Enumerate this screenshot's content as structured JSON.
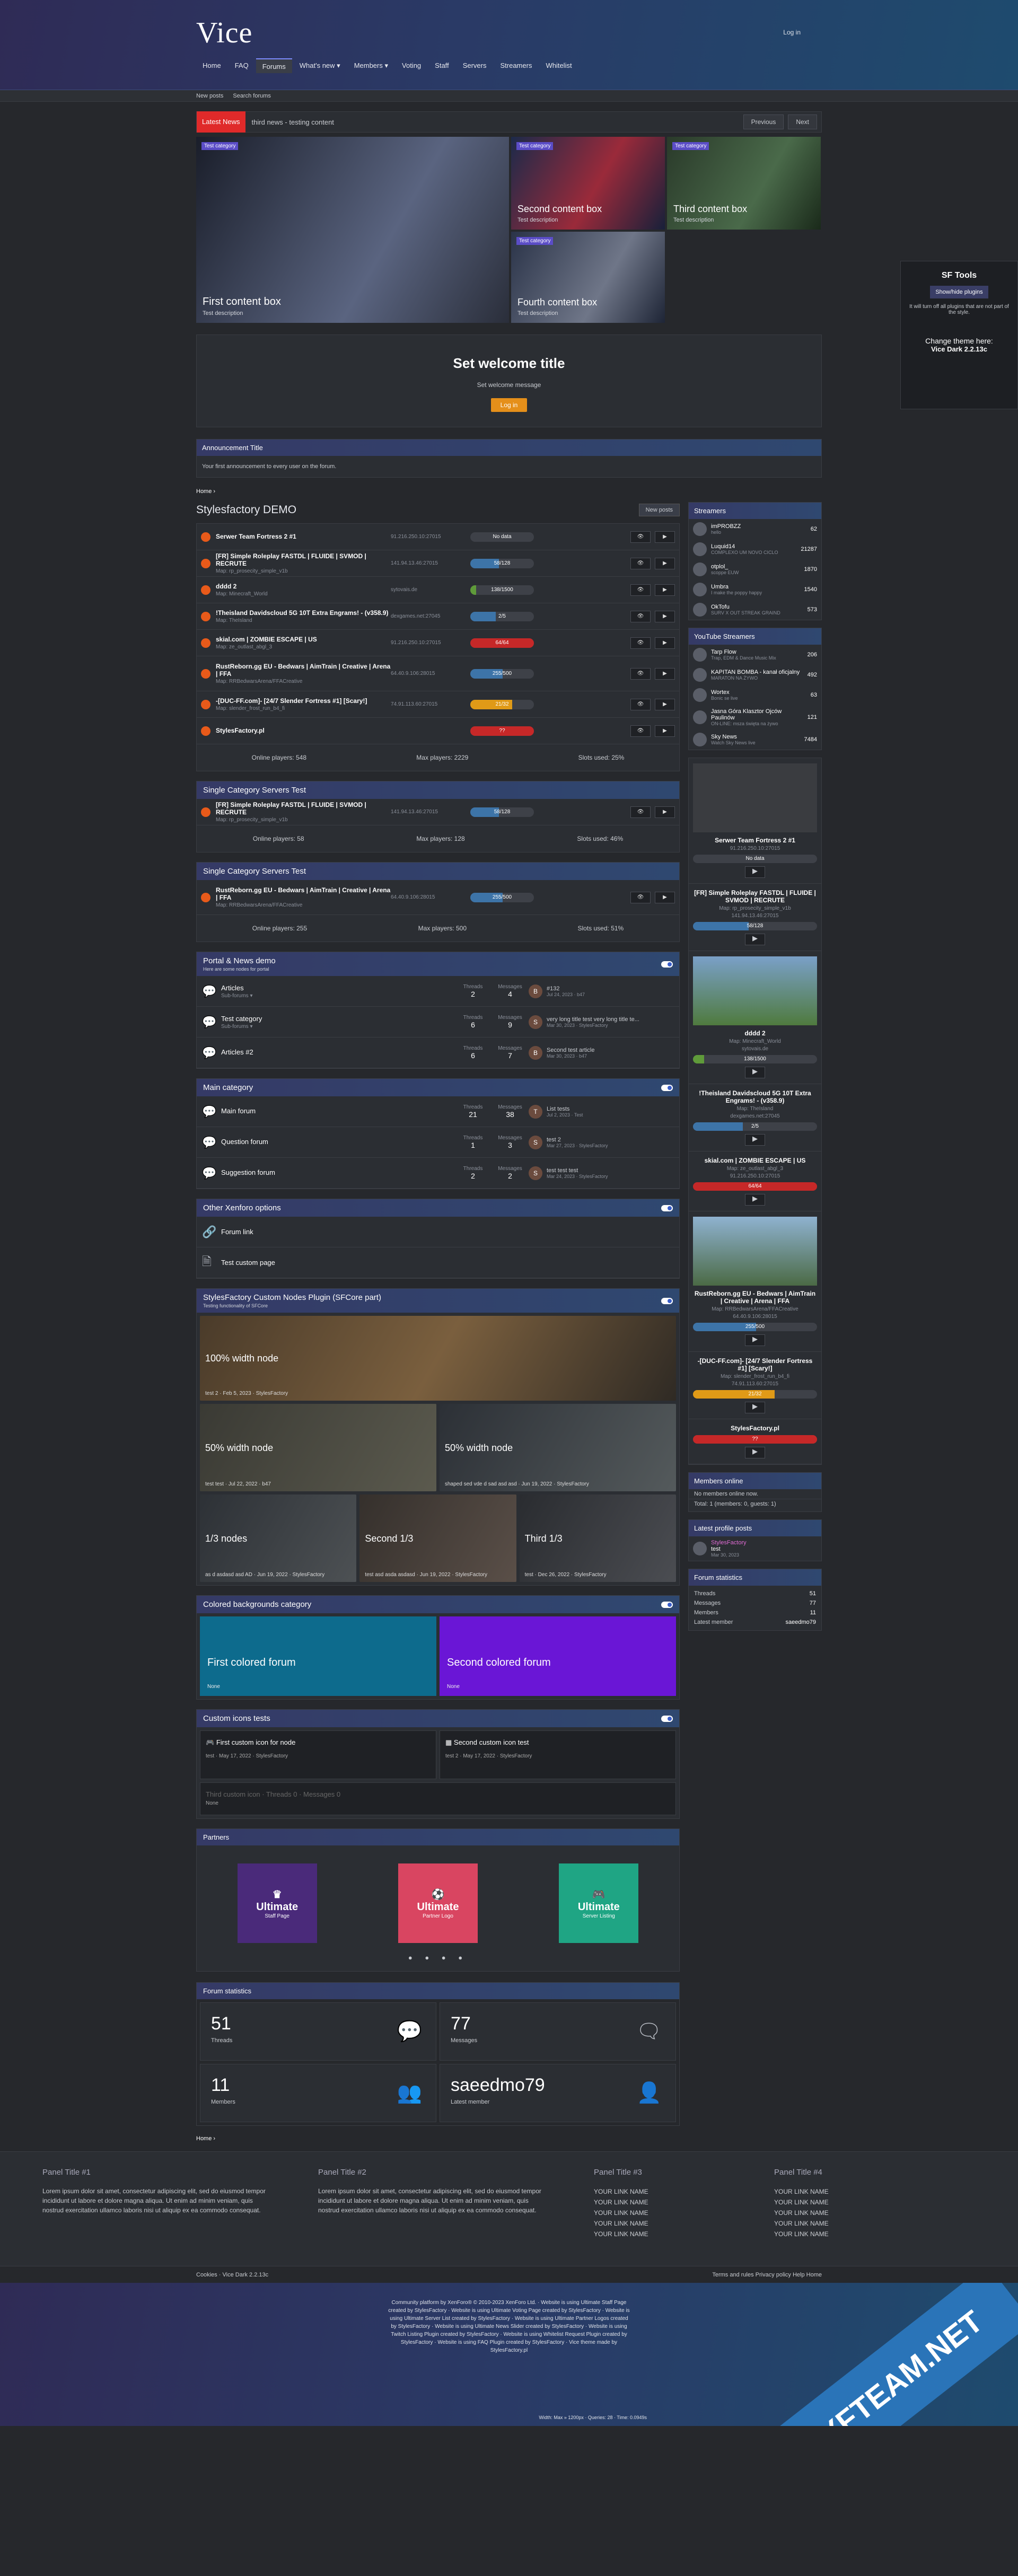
{
  "header": {
    "logo": "Vice",
    "login": "Log in",
    "nav": [
      "Home",
      "FAQ",
      "Forums",
      "What's new ▾",
      "Members ▾",
      "Voting",
      "Staff",
      "Servers",
      "Streamers",
      "Whitelist"
    ],
    "subnav": [
      "New posts",
      "Search forums"
    ]
  },
  "ticker": {
    "label": "Latest News",
    "text": "third news - testing content",
    "prev": "Previous",
    "next": "Next"
  },
  "slides": [
    {
      "tag": "Test category",
      "title": "First content box",
      "desc": "Test description"
    },
    {
      "tag": "Test category",
      "title": "Second content box",
      "desc": "Test description"
    },
    {
      "tag": "Test category",
      "title": "Third content box",
      "desc": "Test description"
    },
    {
      "tag": "Test category",
      "title": "Fourth content box",
      "desc": "Test description"
    }
  ],
  "welcome": {
    "title": "Set welcome title",
    "message": "Set welcome message",
    "button": "Log in"
  },
  "announcement": {
    "title": "Announcement Title",
    "text": "Your first announcement to every user on the forum."
  },
  "crumb": "Home  ›",
  "page": {
    "title": "Stylesfactory DEMO",
    "new_posts": "New posts"
  },
  "servers": [
    {
      "name": "Serwer Team Fortress 2 #1",
      "map": "",
      "ip": "91.216.250.10:27015",
      "players": "No data",
      "pct": 0,
      "color": "#3e4148"
    },
    {
      "name": "[FR] Simple Roleplay FASTDL | FLUIDE | SVMOD | RECRUTE",
      "map": "Map: rp_prosecity_simple_v1b",
      "ip": "141.94.13.46:27015",
      "players": "58/128",
      "pct": 45,
      "color": "#3d74a8"
    },
    {
      "name": "dddd 2",
      "map": "Map: Minecraft_World",
      "ip": "sytovais.de",
      "players": "138/1500",
      "pct": 9,
      "color": "#5f9b3a"
    },
    {
      "name": "!Theisland Davidscloud 5G 10T Extra Engrams! - (v358.9)",
      "map": "Map: TheIsland",
      "ip": "dexgames.net:27045",
      "players": "2/5",
      "pct": 40,
      "color": "#3d74a8"
    },
    {
      "name": "skial.com | ZOMBIE ESCAPE | US",
      "map": "Map: ze_outlast_abgl_3",
      "ip": "91.216.250.10:27015",
      "players": "64/64",
      "pct": 100,
      "color": "#c62828"
    },
    {
      "name": "RustReborn.gg EU - Bedwars | AimTrain | Creative | Arena | FFA",
      "map": "Map: RRBedwarsArena/FFACreative",
      "ip": "64.40.9.106:28015",
      "players": "255/500",
      "pct": 51,
      "color": "#3d74a8"
    },
    {
      "name": "-[DUC-FF.com]- [24/7 Slender Fortress #1] [Scary!]",
      "map": "Map: slender_frost_run_b4_fi",
      "ip": "74.91.113.60:27015",
      "players": "21/32",
      "pct": 66,
      "color": "#e09a17"
    },
    {
      "name": "StylesFactory.pl",
      "map": "",
      "ip": "",
      "players": "??",
      "pct": 100,
      "color": "#c62828"
    }
  ],
  "stats1": {
    "online": "Online players: 548",
    "max": "Max players: 2229",
    "slots": "Slots used: 25%"
  },
  "single1": {
    "title": "Single Category Servers Test",
    "stats": {
      "online": "Online players: 58",
      "max": "Max players: 128",
      "slots": "Slots used: 46%"
    }
  },
  "single2": {
    "title": "Single Category Servers Test",
    "stats": {
      "online": "Online players: 255",
      "max": "Max players: 500",
      "slots": "Slots used: 51%"
    }
  },
  "portal": {
    "title": "Portal & News demo",
    "sub": "Here are some nodes for portal",
    "nodes": [
      {
        "title": "Articles",
        "desc": "Sub-forums ▾",
        "threads": "2",
        "messages": "4",
        "last": "#132",
        "meta": "Jul 24, 2023 · b47",
        "av": "B"
      },
      {
        "title": "Test category",
        "desc": "Sub-forums ▾",
        "threads": "6",
        "messages": "9",
        "last": "very long title test very long title te...",
        "meta": "Mar 30, 2023 · StylesFactory",
        "av": "S"
      },
      {
        "title": "Articles #2",
        "desc": "",
        "threads": "6",
        "messages": "7",
        "last": "Second test article",
        "meta": "Mar 30, 2023 · b47",
        "av": "B"
      }
    ]
  },
  "labels": {
    "threads": "Threads",
    "messages": "Messages"
  },
  "main": {
    "title": "Main category",
    "nodes": [
      {
        "title": "Main forum",
        "threads": "21",
        "messages": "38",
        "last": "List tests",
        "meta": "Jul 2, 2023 · Test",
        "av": "T"
      },
      {
        "title": "Question forum",
        "threads": "1",
        "messages": "3",
        "last": "test 2",
        "meta": "Mar 27, 2023 · StylesFactory",
        "av": "S"
      },
      {
        "title": "Suggestion forum",
        "threads": "2",
        "messages": "2",
        "last": "test test test",
        "meta": "Mar 24, 2023 · StylesFactory",
        "av": "S"
      }
    ]
  },
  "other": {
    "title": "Other Xenforo options",
    "links": [
      "Forum link",
      "Test custom page"
    ]
  },
  "custom_nodes": {
    "title": "StylesFactory Custom Nodes Plugin (SFCore part)",
    "sub": "Testing functionality of SFCore",
    "full": {
      "title": "100% width node",
      "last": "test 2 · Feb 5, 2023 · StylesFactory"
    },
    "half": [
      {
        "title": "50% width node",
        "last": "test test · Jul 22, 2022 · b47"
      },
      {
        "title": "50% width node",
        "last": "shaped sed vde d sad asd asd · Jun 19, 2022 · StylesFactory"
      }
    ],
    "third": [
      {
        "title": "1/3 nodes",
        "last": "as d asdasd asd AD · Jun 19, 2022 · StylesFactory"
      },
      {
        "title": "Second 1/3",
        "last": "test asd asda asdasd · Jun 19, 2022 · StylesFactory"
      },
      {
        "title": "Third 1/3",
        "last": "test · Dec 26, 2022 · StylesFactory"
      }
    ]
  },
  "colored": {
    "title": "Colored backgrounds category",
    "boxes": [
      {
        "title": "First colored forum",
        "last": "None"
      },
      {
        "title": "Second colored forum",
        "last": "None"
      }
    ]
  },
  "icons": {
    "title": "Custom icons tests",
    "nodes": [
      {
        "title": "First custom icon for node",
        "last": "test · May 17, 2022 · StylesFactory"
      },
      {
        "title": "Second custom icon test",
        "last": "test 2 · May 17, 2022 · StylesFactory"
      }
    ],
    "third": "Third custom icon",
    "third_last": "None",
    "threads": "0",
    "messages": "0"
  },
  "partners": {
    "title": "Partners",
    "logos": [
      {
        "name": "Ultimate",
        "sub": "Staff Page"
      },
      {
        "name": "Ultimate",
        "sub": "Partner Logo"
      },
      {
        "name": "Ultimate",
        "sub": "Server Listing"
      }
    ],
    "dots": "● ● ● ●"
  },
  "forum_stats": {
    "title": "Forum statistics",
    "cells": [
      {
        "n": "51",
        "l": "Threads"
      },
      {
        "n": "77",
        "l": "Messages"
      },
      {
        "n": "11",
        "l": "Members"
      },
      {
        "n": "saeedmo79",
        "l": "Latest member"
      }
    ]
  },
  "sidebar": {
    "streamers_title": "Streamers",
    "streamers": [
      {
        "n": "imPROBZZ",
        "s": "hello",
        "v": "62"
      },
      {
        "n": "Luquid14",
        "s": "COMPLEXO UM NOVO CICLO",
        "v": "21287"
      },
      {
        "n": "otplol_",
        "s": "scoppe EUW",
        "v": "1870"
      },
      {
        "n": "Umbra",
        "s": "I make the poppy happy",
        "v": "1540"
      },
      {
        "n": "OkTofu",
        "s": "SURV X OUT STREAK GRAIND",
        "v": "573"
      }
    ],
    "youtube_title": "YouTube Streamers",
    "youtube": [
      {
        "n": "Tarp Flow",
        "s": "Trap, EDM & Dance Music Mix",
        "v": "206"
      },
      {
        "n": "KAPITAN BOMBA - kanał oficjalny",
        "s": "MARATON NA ŻYWO",
        "v": "492"
      },
      {
        "n": "Wortex",
        "s": "Bonic se live",
        "v": "63"
      },
      {
        "n": "Jasna Góra Klasztor Ojców Paulinów",
        "s": "ON-LINE: msza święta na żywo",
        "v": "121"
      },
      {
        "n": "Sky News",
        "s": "Watch Sky News live",
        "v": "7484"
      }
    ],
    "cards": [
      {
        "name": "Serwer Team Fortress 2 #1",
        "map": "",
        "ip": "91.216.250.10:27015",
        "players": "No data",
        "pct": 0,
        "color": "#3e4148"
      },
      {
        "name": "[FR] Simple Roleplay FASTDL | FLUIDE | SVMOD | RECRUTE",
        "map": "Map: rp_prosecity_simple_v1b",
        "ip": "141.94.13.46:27015",
        "players": "58/128",
        "pct": 45,
        "color": "#3d74a8"
      },
      {
        "name": "dddd 2",
        "map": "Map: Minecraft_World",
        "ip": "sytovais.de",
        "players": "138/1500",
        "pct": 9,
        "color": "#5f9b3a"
      },
      {
        "name": "!Theisland Davidscloud 5G 10T Extra Engrams! - (v358.9)",
        "map": "Map: TheIsland",
        "ip": "dexgames.net:27045",
        "players": "2/5",
        "pct": 40,
        "color": "#3d74a8"
      },
      {
        "name": "skial.com | ZOMBIE ESCAPE | US",
        "map": "Map: ze_outlast_abgl_3",
        "ip": "91.216.250.10:27015",
        "players": "64/64",
        "pct": 100,
        "color": "#c62828"
      },
      {
        "name": "RustReborn.gg EU - Bedwars | AimTrain | Creative | Arena | FFA",
        "map": "Map: RRBedwarsArena/FFACreative",
        "ip": "64.40.9.106:28015",
        "players": "255/500",
        "pct": 51,
        "color": "#3d74a8"
      },
      {
        "name": "-[DUC-FF.com]- [24/7 Slender Fortress #1] [Scary!]",
        "map": "Map: slender_frost_run_b4_fi",
        "ip": "74.91.113.60:27015",
        "players": "21/32",
        "pct": 66,
        "color": "#e09a17"
      },
      {
        "name": "StylesFactory.pl",
        "map": "",
        "ip": "",
        "players": "??",
        "pct": 100,
        "color": "#c62828"
      }
    ],
    "members_title": "Members online",
    "members_none": "No members online now.",
    "members_total": "Total: 1 (members: 0, guests: 1)",
    "profile_title": "Latest profile posts",
    "profile": {
      "user": "StylesFactory",
      "text": "test",
      "date": "Mar 30, 2023"
    },
    "stats_title": "Forum statistics",
    "stats": [
      {
        "k": "Threads",
        "v": "51"
      },
      {
        "k": "Messages",
        "v": "77"
      },
      {
        "k": "Members",
        "v": "11"
      },
      {
        "k": "Latest member",
        "v": "saeedmo79"
      }
    ]
  },
  "sftools": {
    "title": "SF Tools",
    "button": "Show/hide plugins",
    "note": "It will turn off all plugins that are not part of the style.",
    "theme": "Change theme here:",
    "theme_name": "Vice Dark 2.2.13c"
  },
  "footer": {
    "cols": [
      {
        "t": "Panel Title #1",
        "p": "Lorem ipsum dolor sit amet, consectetur adipiscing elit, sed do eiusmod tempor incididunt ut labore et dolore magna aliqua. Ut enim ad minim veniam, quis nostrud exercitation ullamco laboris nisi ut aliquip ex ea commodo consequat."
      },
      {
        "t": "Panel Title #2",
        "p": "Lorem ipsum dolor sit amet, consectetur adipiscing elit, sed do eiusmod tempor incididunt ut labore et dolore magna aliqua. Ut enim ad minim veniam, quis nostrud exercitation ullamco laboris nisi ut aliquip ex ea commodo consequat."
      }
    ],
    "links_t3": "Panel Title #3",
    "links_t4": "Panel Title #4",
    "link": "YOUR LINK NAME",
    "bar_left": "Cookies   ·   Vice Dark 2.2.13c",
    "bar_right": "Terms and rules   Privacy policy   Help   Home",
    "copyright": "Community platform by XenForo® © 2010-2023 XenForo Ltd. · Website is using Ultimate Staff Page created by StylesFactory · Website is using Ultimate Voting Page created by StylesFactory · Website is using Ultimate Server List created by StylesFactory · Website is using Ultimate Partner Logos created by StylesFactory · Website is using Ultimate News Slider created by StylesFactory · Website is using Twitch Listing Plugin created by StylesFactory · Website is using Whitelist Request Plugin created by StylesFactory · Website is using FAQ Plugin created by StylesFactory · Vice theme made by StylesFactory.pl",
    "debug": "Width: Max » 1200px · Queries: 28 · Time: 0.0949s"
  },
  "watermark": "XFTEAM.NET"
}
